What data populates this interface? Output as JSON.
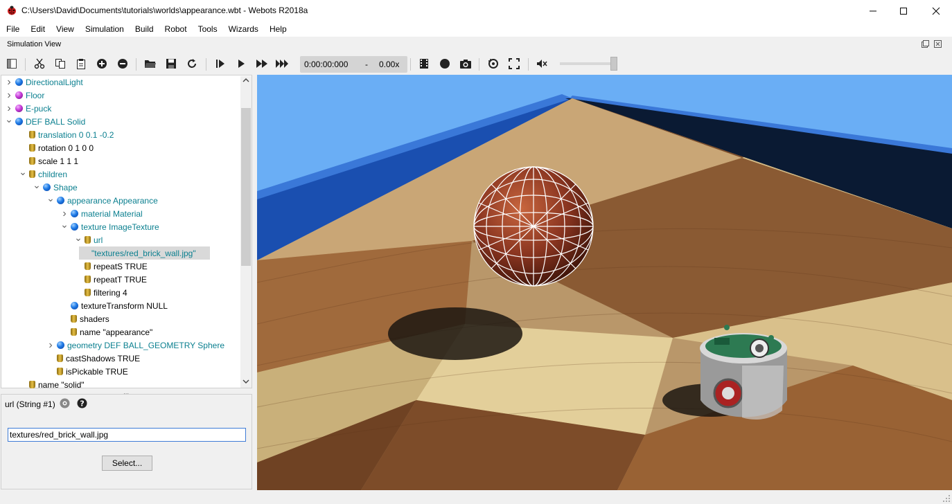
{
  "window": {
    "title": "C:\\Users\\David\\Documents\\tutorials\\worlds\\appearance.wbt - Webots R2018a"
  },
  "menu": [
    "File",
    "Edit",
    "View",
    "Simulation",
    "Build",
    "Robot",
    "Tools",
    "Wizards",
    "Help"
  ],
  "panel": {
    "title": "Simulation View"
  },
  "toolbar": {
    "time": "0:00:00:000",
    "separator": "-",
    "speed": "0.00x"
  },
  "tree": [
    {
      "label": "DirectionalLight",
      "icon": "blue-sphere",
      "color": "teal",
      "expand": "collapsed",
      "depth": 0
    },
    {
      "label": "Floor",
      "icon": "purple-sphere",
      "color": "teal",
      "expand": "collapsed",
      "depth": 0
    },
    {
      "label": "E-puck",
      "icon": "purple-sphere",
      "color": "teal",
      "expand": "collapsed",
      "depth": 0
    },
    {
      "label": "DEF BALL Solid",
      "icon": "blue-sphere",
      "color": "teal",
      "expand": "expanded",
      "depth": 0
    },
    {
      "label": "translation 0 0.1 -0.2",
      "icon": "field-cylinder",
      "color": "teal",
      "expand": "none",
      "depth": 1
    },
    {
      "label": "rotation 0 1 0 0",
      "icon": "field-cylinder",
      "color": "black",
      "expand": "none",
      "depth": 1
    },
    {
      "label": "scale 1 1 1",
      "icon": "field-cylinder",
      "color": "black",
      "expand": "none",
      "depth": 1
    },
    {
      "label": "children",
      "icon": "field-cylinder",
      "color": "teal",
      "expand": "expanded",
      "depth": 1
    },
    {
      "label": "Shape",
      "icon": "blue-sphere",
      "color": "teal",
      "expand": "expanded",
      "depth": 2
    },
    {
      "label": "appearance Appearance",
      "icon": "blue-sphere",
      "color": "teal",
      "expand": "expanded",
      "depth": 3
    },
    {
      "label": "material Material",
      "icon": "blue-sphere",
      "color": "teal",
      "expand": "collapsed",
      "depth": 4
    },
    {
      "label": "texture ImageTexture",
      "icon": "blue-sphere",
      "color": "teal",
      "expand": "expanded",
      "depth": 4
    },
    {
      "label": "url",
      "icon": "field-cylinder",
      "color": "teal",
      "expand": "expanded",
      "depth": 5
    },
    {
      "label": "\"textures/red_brick_wall.jpg\"",
      "icon": "none",
      "color": "teal",
      "expand": "none",
      "depth": 6,
      "selected": true
    },
    {
      "label": "repeatS TRUE",
      "icon": "field-cylinder",
      "color": "black",
      "expand": "none",
      "depth": 5
    },
    {
      "label": "repeatT TRUE",
      "icon": "field-cylinder",
      "color": "black",
      "expand": "none",
      "depth": 5
    },
    {
      "label": "filtering 4",
      "icon": "field-cylinder",
      "color": "black",
      "expand": "none",
      "depth": 5
    },
    {
      "label": "textureTransform NULL",
      "icon": "blue-sphere",
      "color": "black",
      "expand": "none",
      "depth": 4
    },
    {
      "label": "shaders",
      "icon": "field-cylinder",
      "color": "black",
      "expand": "none",
      "depth": 4
    },
    {
      "label": "name \"appearance\"",
      "icon": "field-cylinder",
      "color": "black",
      "expand": "none",
      "depth": 4
    },
    {
      "label": "geometry DEF BALL_GEOMETRY Sphere",
      "icon": "blue-sphere",
      "color": "teal",
      "expand": "collapsed",
      "depth": 3
    },
    {
      "label": "castShadows TRUE",
      "icon": "field-cylinder",
      "color": "black",
      "expand": "none",
      "depth": 3
    },
    {
      "label": "isPickable TRUE",
      "icon": "field-cylinder",
      "color": "black",
      "expand": "none",
      "depth": 3
    },
    {
      "label": "name \"solid\"",
      "icon": "field-cylinder",
      "color": "black",
      "expand": "none",
      "depth": 1
    }
  ],
  "editor": {
    "field_label": "url (String #1)",
    "value": "textures/red_brick_wall.jpg",
    "select_label": "Select..."
  },
  "colors": {
    "teal_text": "#0a7f8f",
    "sky": "#6aaef5",
    "wall_top": "#3a78d8",
    "wall_front": "#0a1a33"
  }
}
